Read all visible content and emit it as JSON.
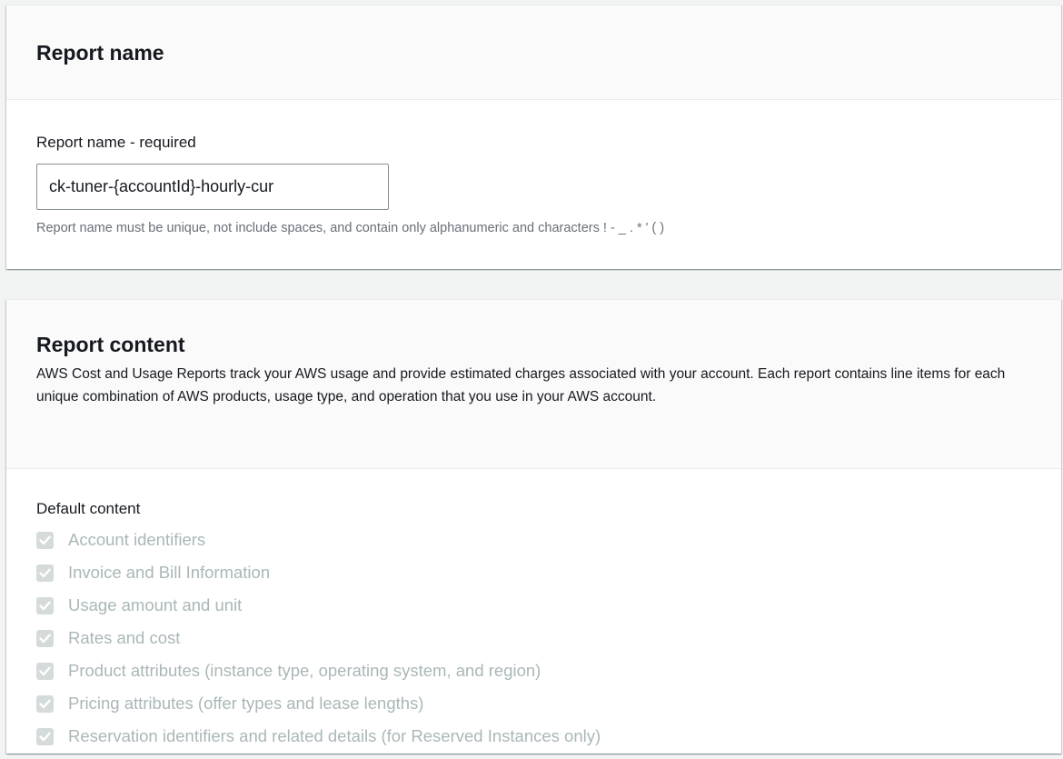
{
  "report_name_section": {
    "title": "Report name",
    "field_label": "Report name - required",
    "field_value": "ck-tuner-{accountId}-hourly-cur",
    "constraint_text": "Report name must be unique, not include spaces, and contain only alphanumeric and characters ! - _ . * ' ( )"
  },
  "report_content_section": {
    "title": "Report content",
    "description": "AWS Cost and Usage Reports track your AWS usage and provide estimated charges associated with your account. Each report contains line items for each unique combination of AWS products, usage type, and operation that you use in your AWS account.",
    "default_content_label": "Default content",
    "checkboxes": [
      {
        "label": "Account identifiers",
        "checked": true,
        "disabled": true
      },
      {
        "label": "Invoice and Bill Information",
        "checked": true,
        "disabled": true
      },
      {
        "label": "Usage amount and unit",
        "checked": true,
        "disabled": true
      },
      {
        "label": "Rates and cost",
        "checked": true,
        "disabled": true
      },
      {
        "label": "Product attributes (instance type, operating system, and region)",
        "checked": true,
        "disabled": true
      },
      {
        "label": "Pricing attributes (offer types and lease lengths)",
        "checked": true,
        "disabled": true
      },
      {
        "label": "Reservation identifiers and related details (for Reserved Instances only)",
        "checked": true,
        "disabled": true
      }
    ]
  },
  "colors": {
    "page_background": "#f2f3f3",
    "panel_header_background": "#fafafa",
    "checkbox_disabled": "#d5dbdb",
    "disabled_text": "#aab7b8",
    "secondary_text": "#687078"
  }
}
